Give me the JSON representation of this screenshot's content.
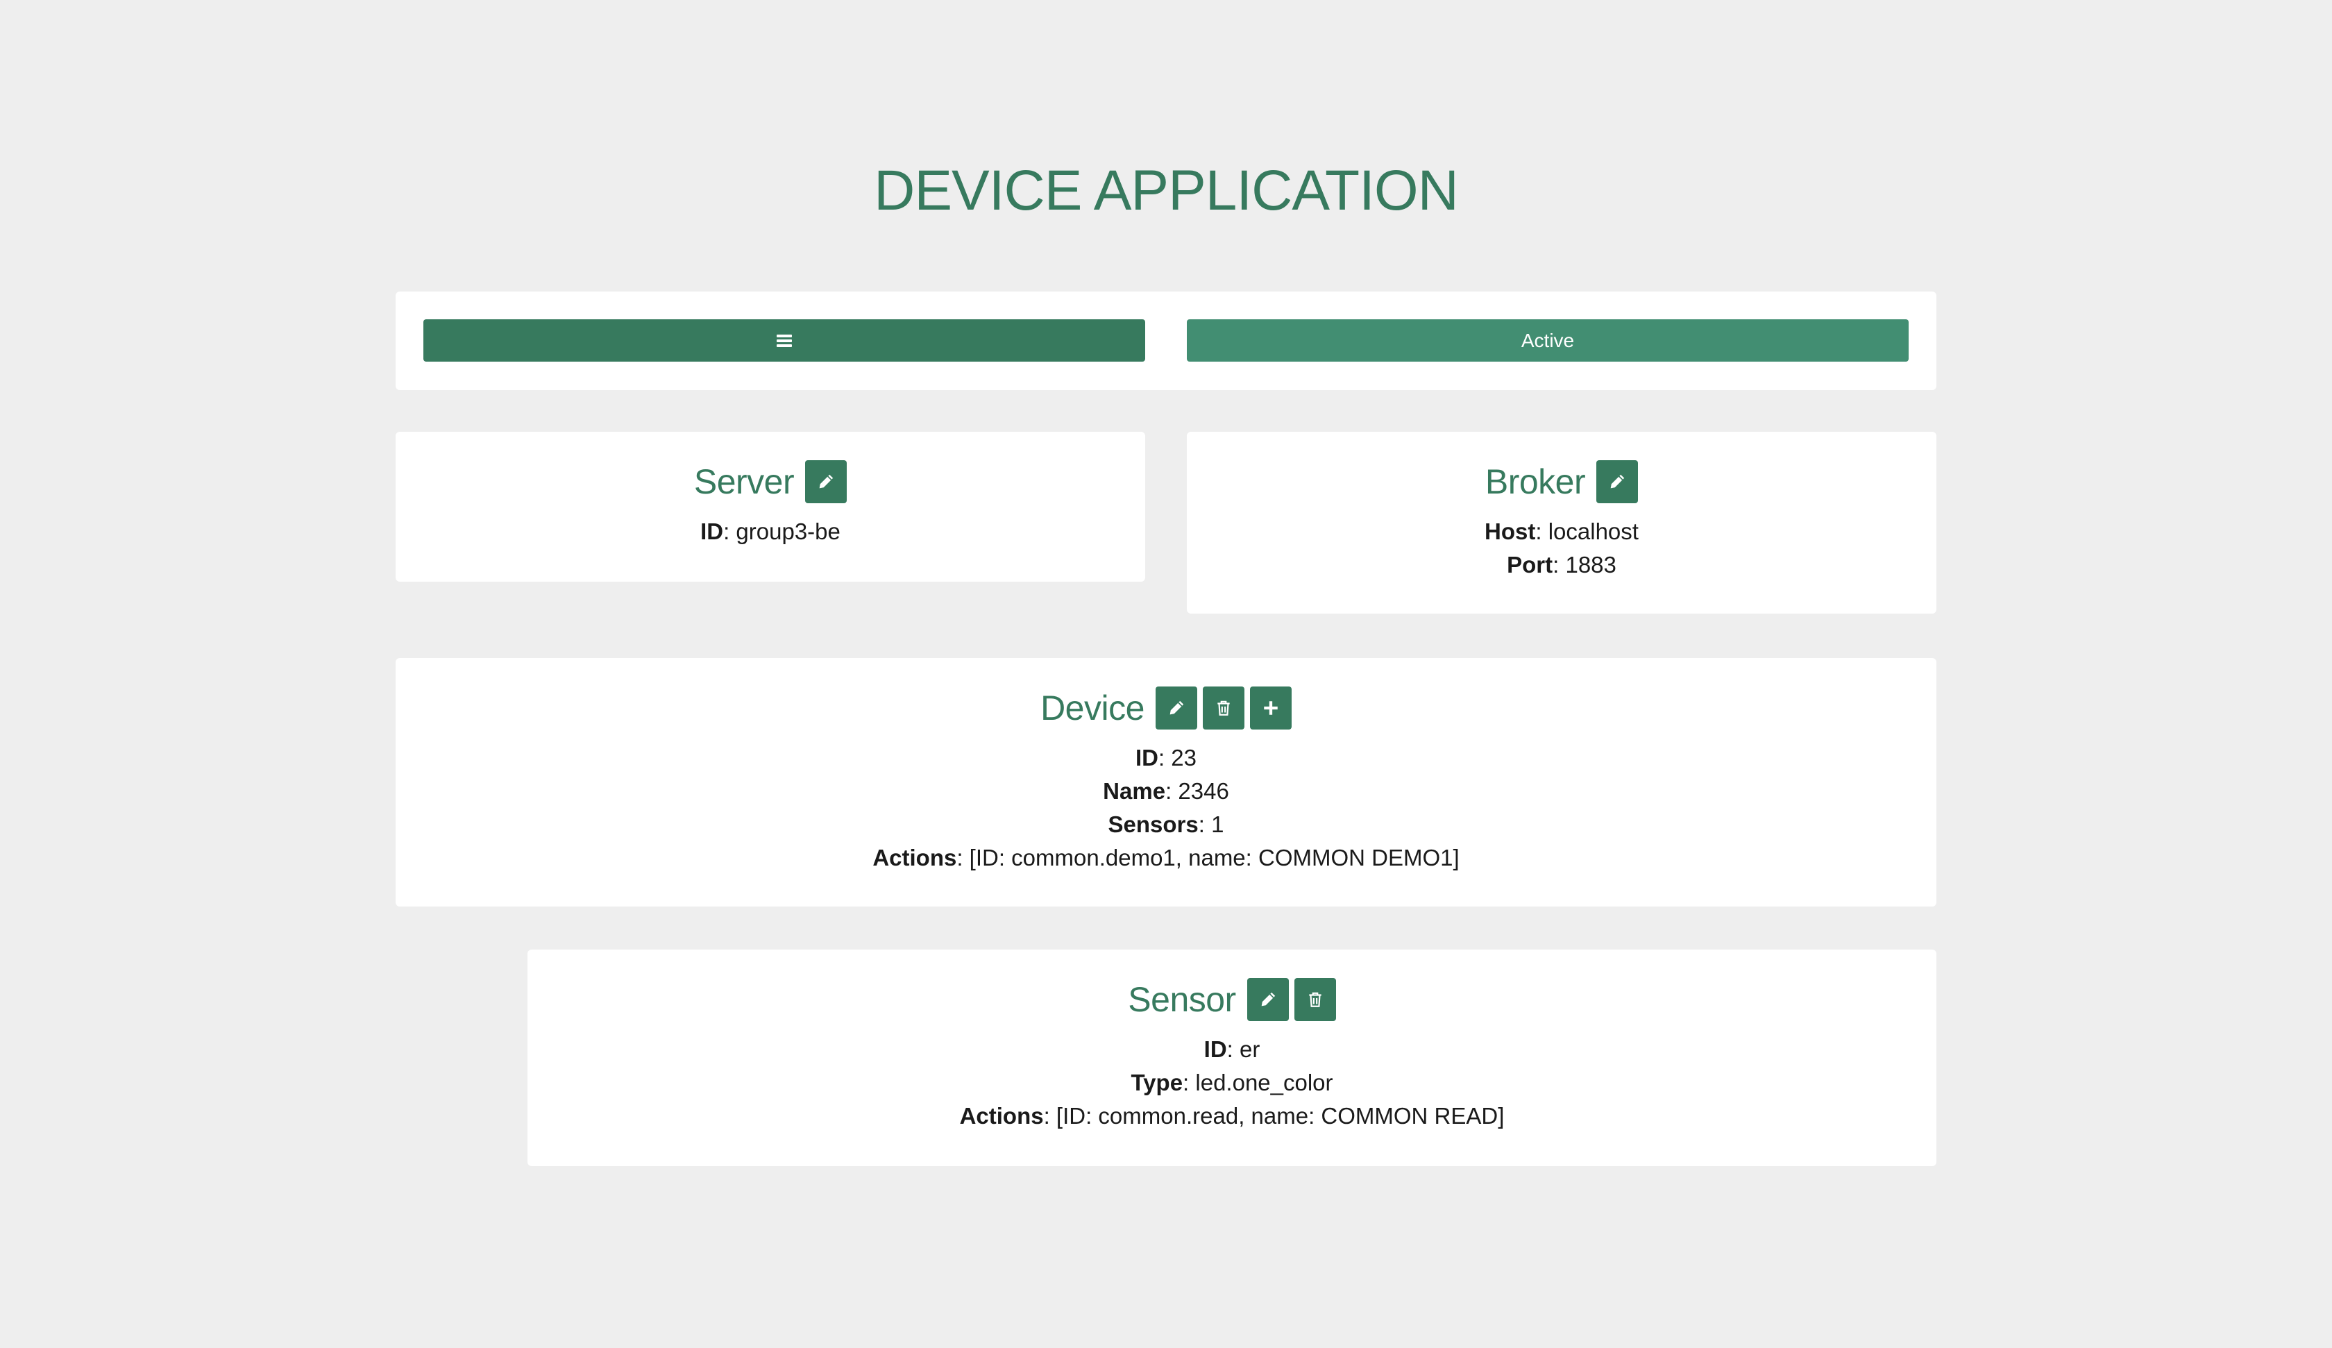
{
  "page": {
    "title": "DEVICE APPLICATION"
  },
  "toolbar": {
    "menu_icon": "hamburger-icon",
    "active_label": "Active"
  },
  "server": {
    "title": "Server",
    "fields": [
      {
        "label": "ID",
        "value": ": group3-be"
      }
    ]
  },
  "broker": {
    "title": "Broker",
    "fields": [
      {
        "label": "Host",
        "value": ": localhost"
      },
      {
        "label": "Port",
        "value": ": 1883"
      }
    ]
  },
  "device": {
    "title": "Device",
    "fields": [
      {
        "label": "ID",
        "value": ": 23"
      },
      {
        "label": "Name",
        "value": ": 2346"
      },
      {
        "label": "Sensors",
        "value": ": 1"
      },
      {
        "label": "Actions",
        "value": ": [ID: common.demo1, name: COMMON DEMO1]"
      }
    ]
  },
  "sensor": {
    "title": "Sensor",
    "fields": [
      {
        "label": "ID",
        "value": ": er"
      },
      {
        "label": "Type",
        "value": ": led.one_color"
      },
      {
        "label": "Actions",
        "value": ": [ID: common.read, name: COMMON READ]"
      }
    ]
  },
  "icons": {
    "edit": "pencil-icon",
    "delete": "trash-icon",
    "add": "plus-icon"
  },
  "colors": {
    "background": "#eeeeee",
    "primary": "#377a5e",
    "active": "#428e72",
    "card": "#ffffff"
  }
}
